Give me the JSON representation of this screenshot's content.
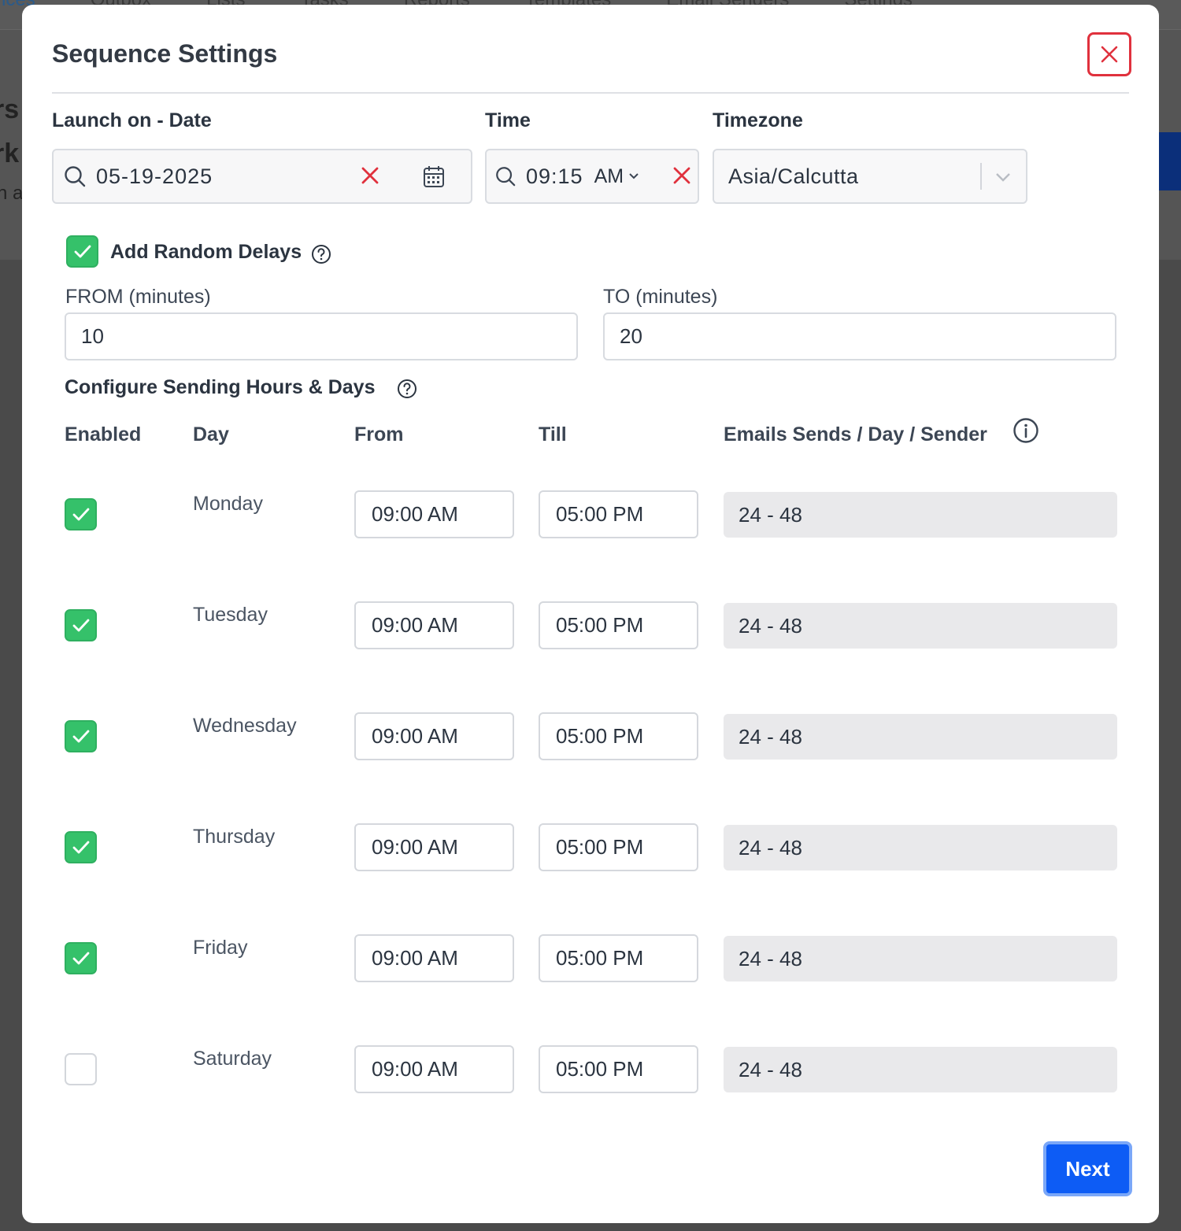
{
  "background": {
    "nav_items": [
      "nces",
      "Outbox",
      "Lists",
      "Tasks",
      "Reports",
      "Templates",
      "Email Senders",
      "Settings"
    ],
    "left_fragments": [
      "rs",
      "rk",
      "n a"
    ]
  },
  "modal": {
    "title": "Sequence Settings",
    "launch": {
      "date_label": "Launch on - Date",
      "date_value": "05-19-2025",
      "time_label": "Time",
      "time_value": "09:15",
      "time_period": "AM",
      "timezone_label": "Timezone",
      "timezone_value": "Asia/Calcutta"
    },
    "random_delays": {
      "label": "Add Random Delays",
      "checked": true,
      "from_label": "FROM (minutes)",
      "from_value": "10",
      "to_label": "TO (minutes)",
      "to_value": "20"
    },
    "schedule": {
      "section_title": "Configure Sending Hours & Days",
      "columns": {
        "enabled": "Enabled",
        "day": "Day",
        "from": "From",
        "till": "Till",
        "sends": "Emails Sends / Day / Sender"
      },
      "rows": [
        {
          "day": "Monday",
          "enabled": true,
          "from": "09:00 AM",
          "till": "05:00 PM",
          "sends": "24 - 48"
        },
        {
          "day": "Tuesday",
          "enabled": true,
          "from": "09:00 AM",
          "till": "05:00 PM",
          "sends": "24 - 48"
        },
        {
          "day": "Wednesday",
          "enabled": true,
          "from": "09:00 AM",
          "till": "05:00 PM",
          "sends": "24 - 48"
        },
        {
          "day": "Thursday",
          "enabled": true,
          "from": "09:00 AM",
          "till": "05:00 PM",
          "sends": "24 - 48"
        },
        {
          "day": "Friday",
          "enabled": true,
          "from": "09:00 AM",
          "till": "05:00 PM",
          "sends": "24 - 48"
        },
        {
          "day": "Saturday",
          "enabled": false,
          "from": "09:00 AM",
          "till": "05:00 PM",
          "sends": "24 - 48"
        }
      ]
    },
    "next_label": "Next"
  },
  "colors": {
    "accent": "#0d5cf5",
    "check": "#35c16a",
    "danger": "#e0313d"
  },
  "icons": [
    "close-icon",
    "search-icon",
    "clear-icon",
    "calendar-icon",
    "chevron-down-icon",
    "help-icon",
    "info-icon",
    "checkmark-icon"
  ]
}
